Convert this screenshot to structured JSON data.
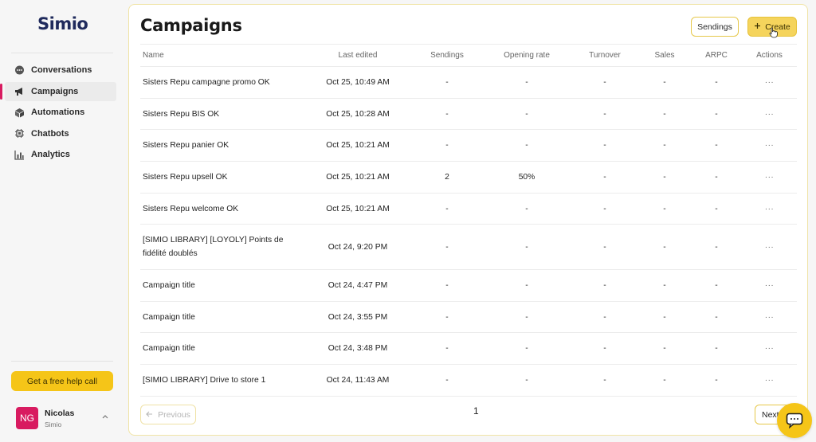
{
  "app": {
    "logo": "Simio"
  },
  "sidebar": {
    "items": [
      {
        "label": "Conversations",
        "icon": "chat-bubble-icon",
        "active": false
      },
      {
        "label": "Campaigns",
        "icon": "megaphone-icon",
        "active": true
      },
      {
        "label": "Automations",
        "icon": "cube-icon",
        "active": false
      },
      {
        "label": "Chatbots",
        "icon": "chip-icon",
        "active": false
      },
      {
        "label": "Analytics",
        "icon": "chart-icon",
        "active": false
      }
    ],
    "help_button": "Get a free help call",
    "user": {
      "initials": "NG",
      "name": "Nicolas",
      "org": "Simio"
    }
  },
  "header": {
    "title": "Campaigns",
    "sendings_button": "Sendings",
    "create_button": "Create"
  },
  "table": {
    "columns": [
      "Name",
      "Last edited",
      "Sendings",
      "Opening rate",
      "Turnover",
      "Sales",
      "ARPC",
      "Actions"
    ],
    "rows": [
      {
        "name": "Sisters Repu campagne promo OK",
        "edited": "Oct 25, 10:49 AM",
        "sendings": "-",
        "opening": "-",
        "turnover": "-",
        "sales": "-",
        "arpc": "-",
        "actions": "···"
      },
      {
        "name": "Sisters Repu BIS OK",
        "edited": "Oct 25, 10:28 AM",
        "sendings": "-",
        "opening": "-",
        "turnover": "-",
        "sales": "-",
        "arpc": "-",
        "actions": "···"
      },
      {
        "name": "Sisters Repu panier OK",
        "edited": "Oct 25, 10:21 AM",
        "sendings": "-",
        "opening": "-",
        "turnover": "-",
        "sales": "-",
        "arpc": "-",
        "actions": "···"
      },
      {
        "name": "Sisters Repu upsell OK",
        "edited": "Oct 25, 10:21 AM",
        "sendings": "2",
        "opening": "50%",
        "turnover": "-",
        "sales": "-",
        "arpc": "-",
        "actions": "···"
      },
      {
        "name": "Sisters Repu welcome OK",
        "edited": "Oct 25, 10:21 AM",
        "sendings": "-",
        "opening": "-",
        "turnover": "-",
        "sales": "-",
        "arpc": "-",
        "actions": "···"
      },
      {
        "name_line1": "[SIMIO LIBRARY] [LOYOLY] Points de",
        "name_line2": "fidélité doublés",
        "edited": "Oct 24, 9:20 PM",
        "sendings": "-",
        "opening": "-",
        "turnover": "-",
        "sales": "-",
        "arpc": "-",
        "actions": "···"
      },
      {
        "name": "Campaign title",
        "edited": "Oct 24, 4:47 PM",
        "sendings": "-",
        "opening": "-",
        "turnover": "-",
        "sales": "-",
        "arpc": "-",
        "actions": "···"
      },
      {
        "name": "Campaign title",
        "edited": "Oct 24, 3:55 PM",
        "sendings": "-",
        "opening": "-",
        "turnover": "-",
        "sales": "-",
        "arpc": "-",
        "actions": "···"
      },
      {
        "name": "Campaign title",
        "edited": "Oct 24, 3:48 PM",
        "sendings": "-",
        "opening": "-",
        "turnover": "-",
        "sales": "-",
        "arpc": "-",
        "actions": "···"
      },
      {
        "name": "[SIMIO LIBRARY] Drive to store 1",
        "edited": "Oct 24, 11:43 AM",
        "sendings": "-",
        "opening": "-",
        "turnover": "-",
        "sales": "-",
        "arpc": "-",
        "actions": "···"
      }
    ]
  },
  "pagination": {
    "previous": "Previous",
    "current_page": "1",
    "next": "Next"
  },
  "colors": {
    "accent": "#f5c518",
    "brand": "#1f2a5c",
    "active_marker": "#d81b60"
  }
}
